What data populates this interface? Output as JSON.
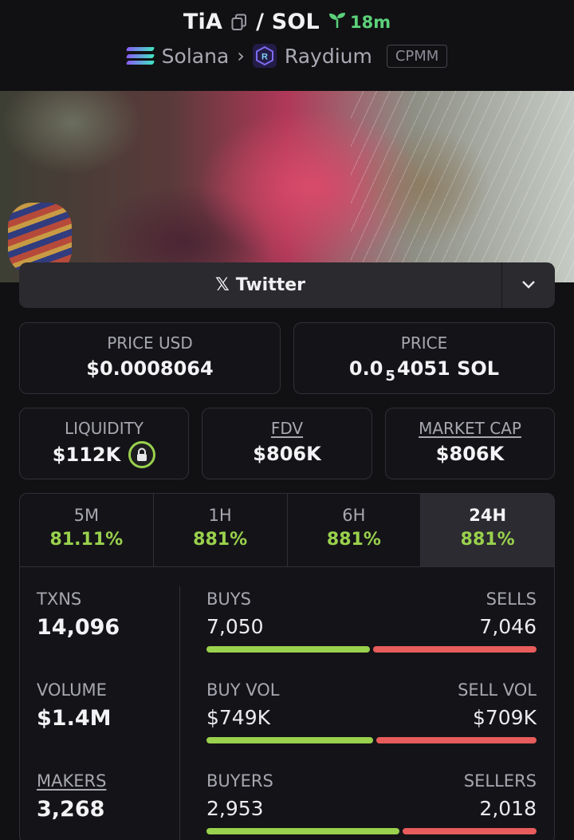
{
  "header": {
    "title": "TiA",
    "pair_sep": "/ SOL",
    "age": "18m",
    "chain": "Solana",
    "dex": "Raydium",
    "pool_type": "CPMM",
    "accent_green": "#5cd17a"
  },
  "social": {
    "label": "Twitter"
  },
  "price": {
    "usd_label": "PRICE USD",
    "usd_value": "$0.0008064",
    "native_label": "PRICE",
    "native_prefix": "0.0",
    "native_subscript": "5",
    "native_suffix": "4051 SOL"
  },
  "metrics": {
    "liquidity_label": "LIQUIDITY",
    "liquidity_value": "$112K",
    "fdv_label": "FDV",
    "fdv_value": "$806K",
    "mcap_label": "MARKET CAP",
    "mcap_value": "$806K"
  },
  "tabs": [
    {
      "label": "5M",
      "value": "81.11%"
    },
    {
      "label": "1H",
      "value": "881%"
    },
    {
      "label": "6H",
      "value": "881%"
    },
    {
      "label": "24H",
      "value": "881%"
    }
  ],
  "active_tab": "24H",
  "stats": {
    "txns_label": "TXNS",
    "txns_value": "14,096",
    "buys_label": "BUYS",
    "buys_value": "7,050",
    "sells_label": "SELLS",
    "sells_value": "7,046",
    "volume_label": "VOLUME",
    "volume_value": "$1.4M",
    "buyvol_label": "BUY VOL",
    "buyvol_value": "$749K",
    "sellvol_label": "SELL VOL",
    "sellvol_value": "$709K",
    "makers_label": "MAKERS",
    "makers_value": "3,268",
    "buyers_label": "BUYERS",
    "buyers_value": "2,953",
    "sellers_label": "SELLERS",
    "sellers_value": "2,018"
  },
  "ratios": {
    "txns_buy_fraction": 0.5,
    "volume_buy_fraction": 0.51,
    "makers_buy_fraction": 0.59
  },
  "colors": {
    "buy": "#9ad14d",
    "sell": "#e85c5c"
  }
}
